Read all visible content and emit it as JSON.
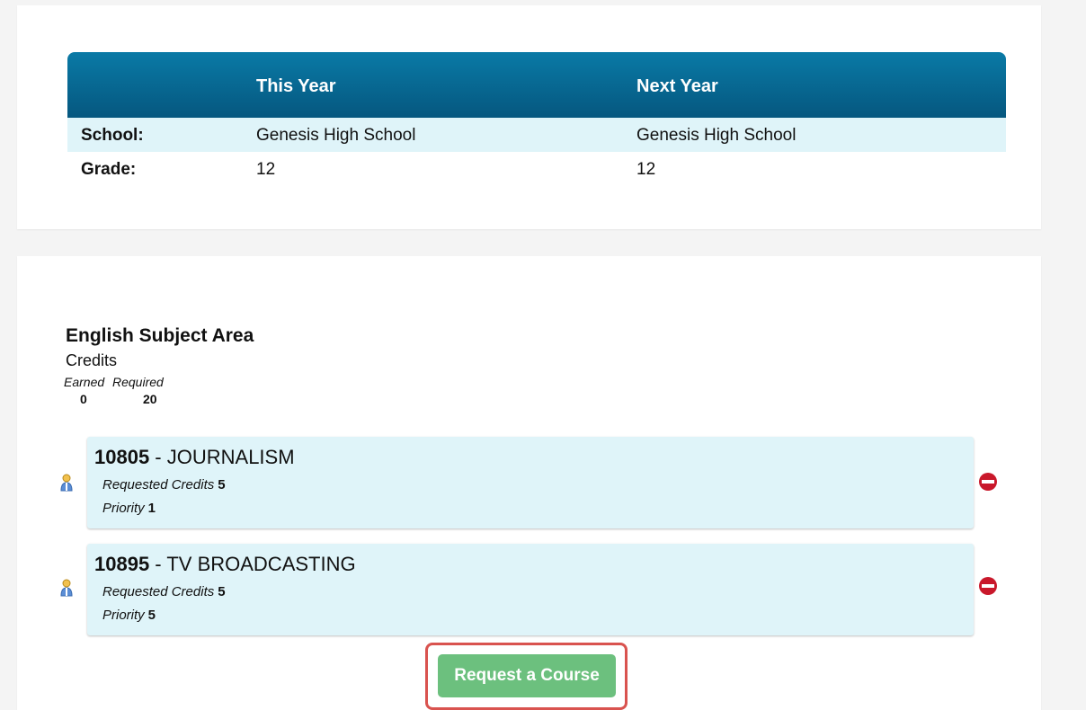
{
  "info": {
    "headers": [
      "",
      "This Year",
      "Next Year"
    ],
    "rows": [
      {
        "label": "School:",
        "this_year": "Genesis High School",
        "next_year": "Genesis High School"
      },
      {
        "label": "Grade:",
        "this_year": "12",
        "next_year": "12"
      }
    ]
  },
  "subject": {
    "title": "English Subject Area",
    "credits_label": "Credits",
    "earned_label": "Earned",
    "required_label": "Required",
    "earned_value": "0",
    "required_value": "20"
  },
  "courses": [
    {
      "code": "10805",
      "separator": " - ",
      "name": "JOURNALISM",
      "credits_label": "Requested Credits",
      "credits": "5",
      "priority_label": "Priority",
      "priority": "1"
    },
    {
      "code": "10895",
      "separator": " - ",
      "name": "TV BROADCASTING",
      "credits_label": "Requested Credits",
      "credits": "5",
      "priority_label": "Priority",
      "priority": "5"
    }
  ],
  "request_button": {
    "label": "Request a Course",
    "color": "#6cc07e"
  },
  "icons": {
    "person": "person-icon",
    "remove": "remove-icon"
  },
  "colors": {
    "header_bg": "#05577f",
    "row_alt": "#dff4f9",
    "remove": "#c9182b",
    "highlight": "#d9534f"
  }
}
